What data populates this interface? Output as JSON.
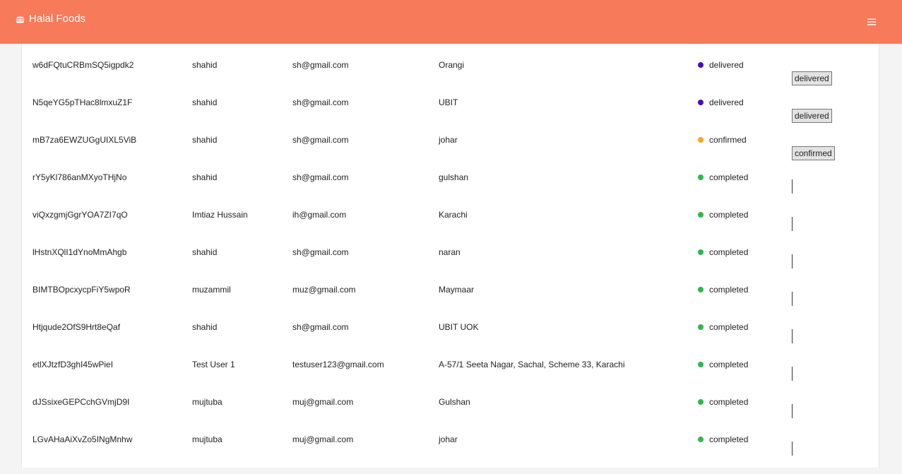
{
  "header": {
    "brand": "Halal Foods",
    "brand_icon": "burger-icon",
    "menu_icon": "hamburger-menu-icon",
    "background": "#f77b5b"
  },
  "status_colors": {
    "delivered": "#4b0cb8",
    "confirmed": "#f5a623",
    "completed": "#2fb84a"
  },
  "orders": [
    {
      "id": "w6dFQtuCRBmSQ5igpdk2",
      "name": "shahid",
      "email": "sh@gmail.com",
      "address": "Orangi",
      "status": "delivered",
      "select": "delivered"
    },
    {
      "id": "N5qeYG5pTHac8lmxuZ1F",
      "name": "shahid",
      "email": "sh@gmail.com",
      "address": "UBIT",
      "status": "delivered",
      "select": "delivered"
    },
    {
      "id": "mB7za6EWZUGgUIXL5ViB",
      "name": "shahid",
      "email": "sh@gmail.com",
      "address": "johar",
      "status": "confirmed",
      "select": "confirmed"
    },
    {
      "id": "rY5yKl786anMXyoTHjNo",
      "name": "shahid",
      "email": "sh@gmail.com",
      "address": "gulshan",
      "status": "completed",
      "select": ""
    },
    {
      "id": "viQxzgmjGgrYOA7ZI7qO",
      "name": "Imtiaz Hussain",
      "email": "ih@gmail.com",
      "address": "Karachi",
      "status": "completed",
      "select": ""
    },
    {
      "id": "lHstnXQlI1dYnoMmAhgb",
      "name": "shahid",
      "email": "sh@gmail.com",
      "address": "naran",
      "status": "completed",
      "select": ""
    },
    {
      "id": "BIMTBOpcxycpFiY5wpoR",
      "name": "muzammil",
      "email": "muz@gmail.com",
      "address": "Maymaar",
      "status": "completed",
      "select": ""
    },
    {
      "id": "Htjqude2OfS9Hrt8eQaf",
      "name": "shahid",
      "email": "sh@gmail.com",
      "address": "UBIT UOK",
      "status": "completed",
      "select": ""
    },
    {
      "id": "etlXJtzfD3ghI45wPieI",
      "name": "Test User 1",
      "email": "testuser123@gmail.com",
      "address": "A-57/1 Seeta Nagar, Sachal, Scheme 33, Karachi",
      "status": "completed",
      "select": ""
    },
    {
      "id": "dJSsixeGEPCchGVmjD9I",
      "name": "mujtuba",
      "email": "muj@gmail.com",
      "address": "Gulshan",
      "status": "completed",
      "select": ""
    },
    {
      "id": "LGvAHaAiXvZo5INgMnhw",
      "name": "mujtuba",
      "email": "muj@gmail.com",
      "address": "johar",
      "status": "completed",
      "select": ""
    }
  ]
}
